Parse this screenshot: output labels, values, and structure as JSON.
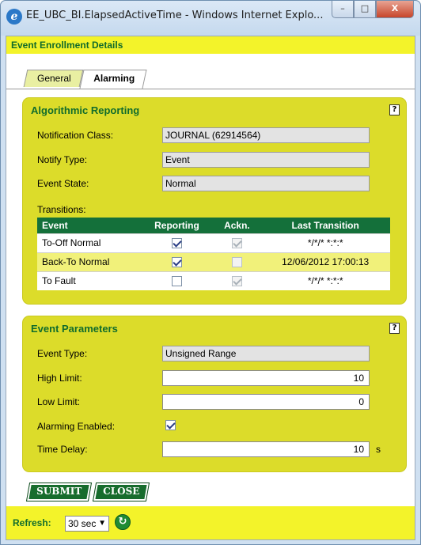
{
  "window": {
    "title": "EE_UBC_BI.ElapsedActiveTime - Windows Internet Explo...",
    "controls": {
      "minimize": "–",
      "maximize": "□",
      "close": "X"
    }
  },
  "header": {
    "title": "Event Enrollment Details"
  },
  "tabs": [
    {
      "label": "General",
      "active": false
    },
    {
      "label": "Alarming",
      "active": true
    }
  ],
  "algorithmic": {
    "title": "Algorithmic Reporting",
    "help": "?",
    "notification_class_label": "Notification Class:",
    "notification_class_value": "JOURNAL (62914564)",
    "notify_type_label": "Notify Type:",
    "notify_type_value": "Event",
    "event_state_label": "Event State:",
    "event_state_value": "Normal",
    "transitions_label": "Transitions:",
    "table": {
      "headers": [
        "Event",
        "Reporting",
        "Ackn.",
        "Last Transition"
      ],
      "rows": [
        {
          "event": "To-Off Normal",
          "reporting": true,
          "ackn": true,
          "last": "*/*/* *:*:*"
        },
        {
          "event": "Back-To Normal",
          "reporting": true,
          "ackn": false,
          "last": "12/06/2012 17:00:13"
        },
        {
          "event": "To Fault",
          "reporting": false,
          "ackn": true,
          "last": "*/*/* *:*:*"
        }
      ]
    }
  },
  "parameters": {
    "title": "Event Parameters",
    "help": "?",
    "event_type_label": "Event Type:",
    "event_type_value": "Unsigned Range",
    "high_limit_label": "High Limit:",
    "high_limit_value": "10",
    "low_limit_label": "Low Limit:",
    "low_limit_value": "0",
    "alarming_enabled_label": "Alarming Enabled:",
    "alarming_enabled": true,
    "time_delay_label": "Time Delay:",
    "time_delay_value": "10",
    "time_delay_unit": "s"
  },
  "buttons": {
    "submit": "SUBMIT",
    "close": "CLOSE"
  },
  "footer": {
    "refresh_label": "Refresh:",
    "refresh_value": "30 sec",
    "refresh_icon": "refresh-icon"
  },
  "colors": {
    "accent_yellow": "#f3f32a",
    "panel_yellow": "#dcdc2a",
    "brand_green": "#14703a"
  }
}
